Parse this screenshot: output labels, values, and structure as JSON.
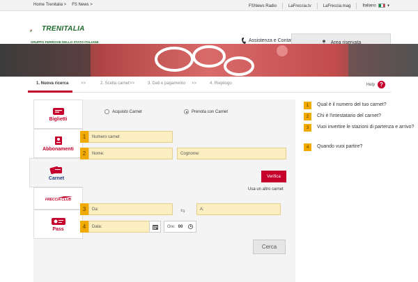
{
  "topbar": {
    "links_left": [
      "Home Trenitalia >",
      "FS News >"
    ],
    "links_right": [
      "FSNews Radio",
      "LaFreccia.tv",
      "LaFreccia.mag",
      "Italiano"
    ]
  },
  "header": {
    "brand": "TRENITALIA",
    "brand_sub": "GRUPPO FERROVIE DELLO STATO ITALIANE",
    "assistance": "Assistenza e Contatti",
    "reserved_area": "Area riservata"
  },
  "steps": {
    "items": [
      "1. Nuova ricerca",
      "2. Scelta carnet",
      "3. Dati e pagamento",
      "4. Riepilogo"
    ],
    "separator": ">>",
    "help": "Help",
    "help_symbol": "?"
  },
  "sidebar": {
    "items": [
      {
        "label": "Biglietti",
        "icon": "ticket-icon"
      },
      {
        "label": "Abbonamenti",
        "icon": "pass-icon"
      },
      {
        "label": "Carnet",
        "icon": "carnet-icon"
      },
      {
        "label": "",
        "icon": "frecciaclub-icon",
        "logo_text": "FRECCIA CLUB"
      },
      {
        "label": "Pass",
        "icon": "pass-ticket-icon"
      }
    ]
  },
  "form": {
    "radio_options": [
      {
        "label": "Acquisto Carnet",
        "selected": false
      },
      {
        "label": "Prenota con Carnet",
        "selected": true
      }
    ],
    "step_numbers": [
      "1",
      "2",
      "3",
      "4"
    ],
    "carnet_number_placeholder": "Numero carnet",
    "first_name_placeholder": "Nome:",
    "last_name_placeholder": "Cognome:",
    "verify_button": "Verifica",
    "other_carnet_link": "Usa un altro carnet",
    "from_placeholder": "Da:",
    "to_placeholder": "A:",
    "date_placeholder": "Data:",
    "time_label": "Ore:",
    "time_value": "00",
    "search_button": "Cerca"
  },
  "faq": [
    {
      "num": "1",
      "text": "Qual è il numero del tuo carnet?"
    },
    {
      "num": "2",
      "text": "Chi è l'intestatario del carnet?"
    },
    {
      "num": "3",
      "text": "Vuoi invertire le stazioni di partenza e arrivo?"
    },
    {
      "num": "4",
      "text": "Quando vuoi partire?"
    }
  ],
  "colors": {
    "accent_red": "#c4002b",
    "highlight_yellow": "#f2a900",
    "field_yellow": "#fbeec0",
    "brand_green": "#1e6a2c"
  }
}
